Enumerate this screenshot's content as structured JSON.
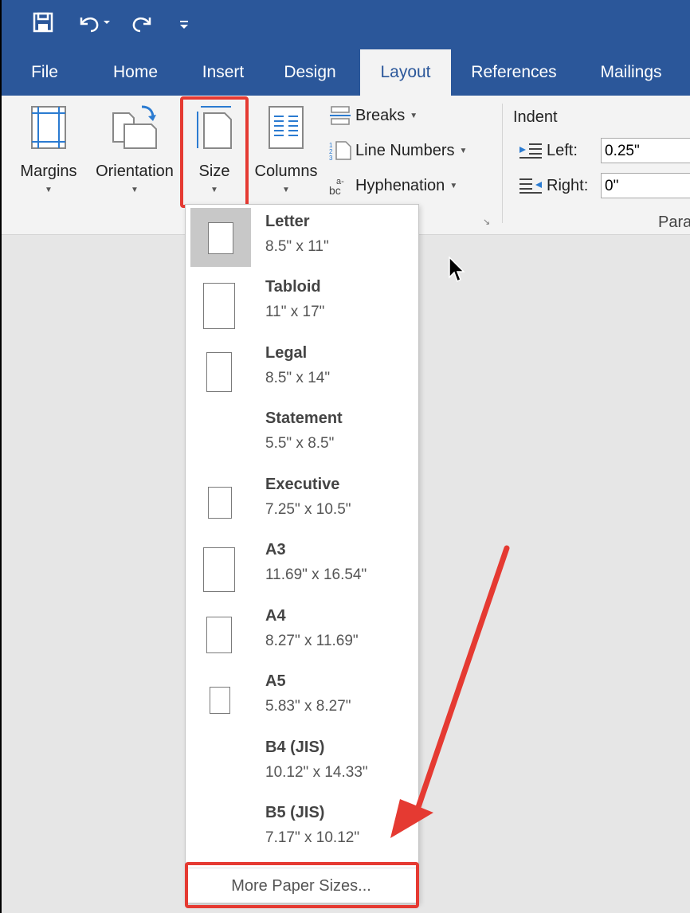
{
  "tabs": [
    "File",
    "Home",
    "Insert",
    "Design",
    "Layout",
    "References",
    "Mailings"
  ],
  "ribbon": {
    "margins": "Margins",
    "orientation": "Orientation",
    "size": "Size",
    "columns": "Columns",
    "breaks": "Breaks",
    "line_numbers": "Line Numbers",
    "hyphenation": "Hyphenation",
    "indent_title": "Indent",
    "left_label": "Left:",
    "left_value": "0.25\"",
    "right_label": "Right:",
    "right_value": "0\"",
    "group_partial": "Para"
  },
  "sizes": [
    {
      "name": "Letter",
      "dims": "8.5\" x 11\""
    },
    {
      "name": "Tabloid",
      "dims": "11\" x 17\""
    },
    {
      "name": "Legal",
      "dims": "8.5\" x 14\""
    },
    {
      "name": "Statement",
      "dims": "5.5\" x 8.5\""
    },
    {
      "name": "Executive",
      "dims": "7.25\" x 10.5\""
    },
    {
      "name": "A3",
      "dims": "11.69\" x 16.54\""
    },
    {
      "name": "A4",
      "dims": "8.27\" x 11.69\""
    },
    {
      "name": "A5",
      "dims": "5.83\" x 8.27\""
    },
    {
      "name": "B4 (JIS)",
      "dims": "10.12\" x 14.33\""
    },
    {
      "name": "B5 (JIS)",
      "dims": "7.17\" x 10.12\""
    }
  ],
  "more_sizes": "More Paper Sizes...",
  "colors": {
    "title_bar": "#2b579a",
    "highlight": "#e53a32"
  }
}
